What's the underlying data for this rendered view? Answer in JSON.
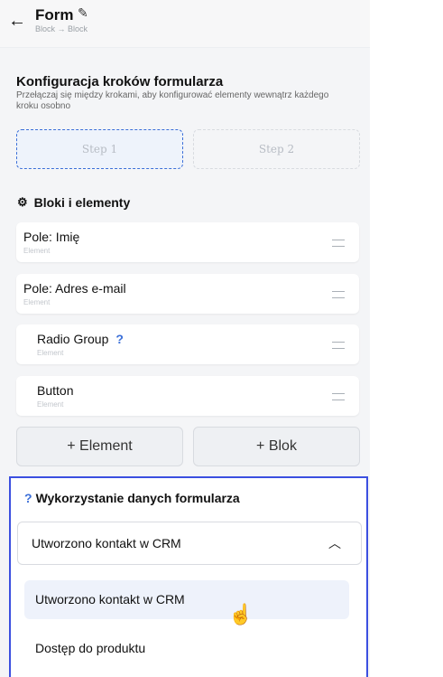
{
  "header": {
    "back_icon": "arrow-left-icon",
    "title": "Form",
    "edit_icon": "pencil-icon",
    "breadcrumb": "Block → Block"
  },
  "config": {
    "title": "Konfiguracja kroków formularza",
    "description": "Przełączaj się między krokami, aby konfigurować elementy wewnątrz każdego kroku osobno",
    "steps": [
      "Step 1",
      "Step 2"
    ],
    "active_step": "Step 1"
  },
  "blocks": {
    "title": "Bloki i elementy",
    "icon": "cube-icon",
    "items": [
      {
        "name": "Pole: Imię",
        "type": "Element"
      },
      {
        "name": "Pole: Adres e-mail",
        "type": "Element"
      },
      {
        "name": "Radio Group",
        "type": "Element",
        "help": "?"
      },
      {
        "name": "Button",
        "type": "Element"
      }
    ],
    "add_element": "+ Element",
    "add_block": "+ Blok"
  },
  "usage": {
    "help": "?",
    "title": "Wykorzystanie danych formularza",
    "selected": "Utworzono kontakt w CRM",
    "chevron": "chevron-up-icon",
    "options": [
      "Utworzono kontakt w CRM",
      "Dostęp do produktu"
    ],
    "highlighted_option": "Utworzono kontakt w CRM"
  },
  "colors": {
    "accent": "#3b6fd8",
    "focus_border": "#3b4fe0",
    "panel_bg": "#f4f5f7"
  }
}
